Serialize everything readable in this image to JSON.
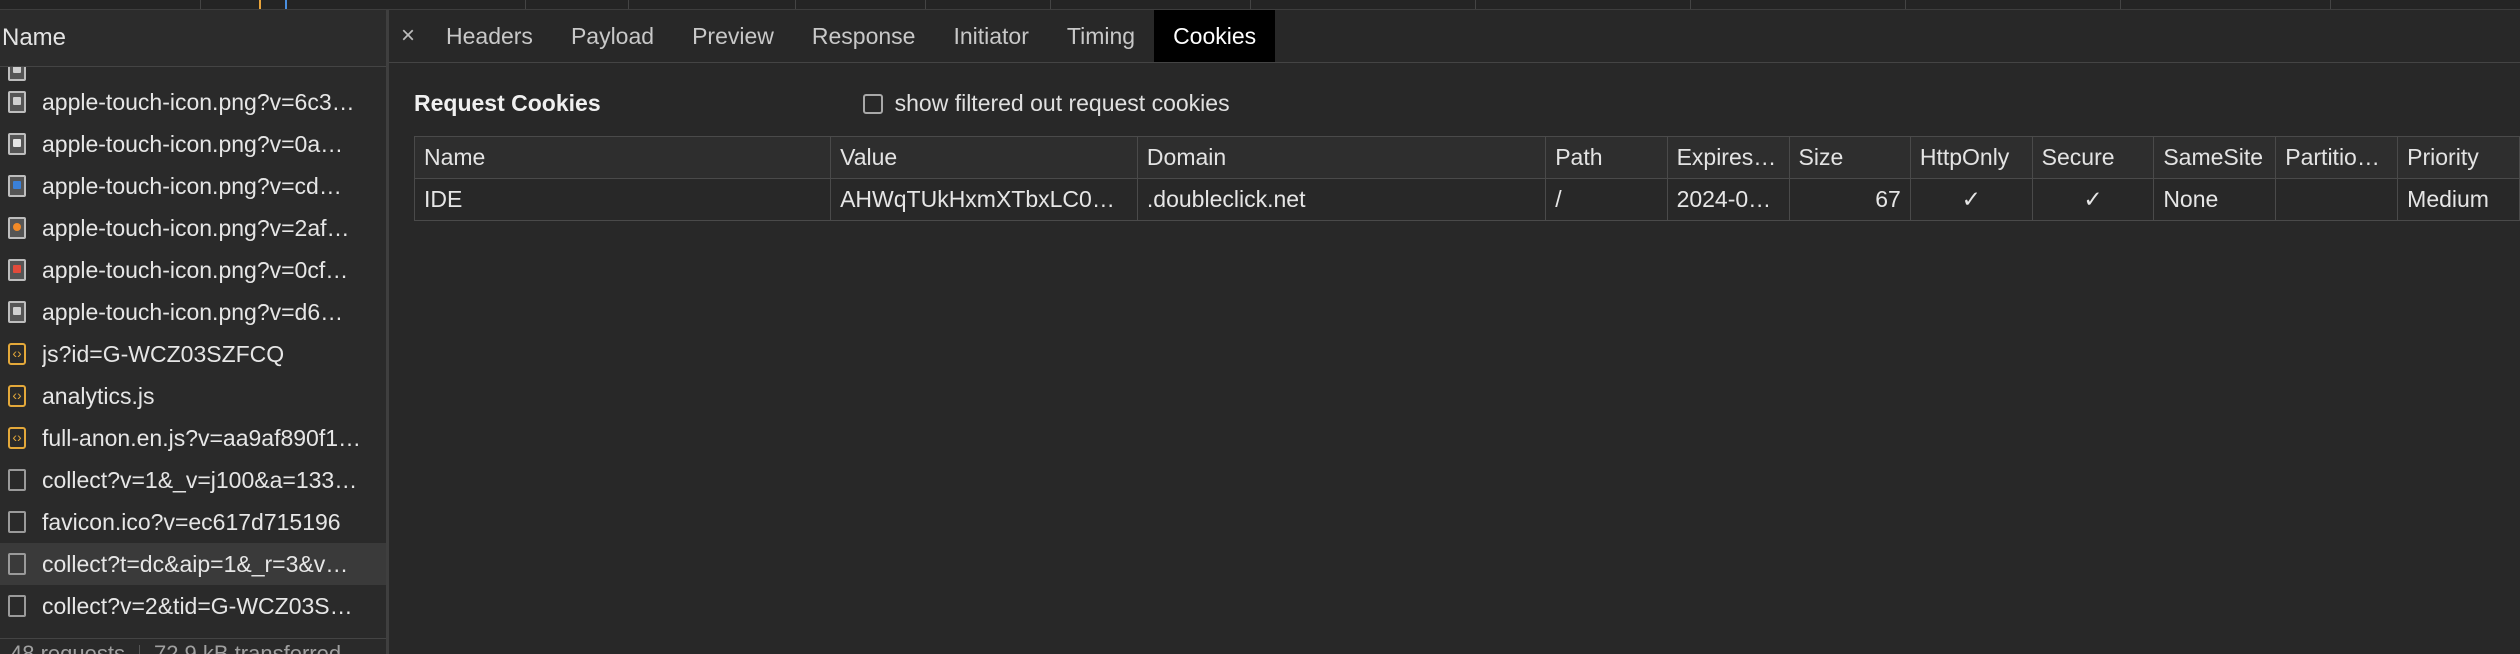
{
  "request_list": {
    "column_header": "Name",
    "requests": [
      {
        "name": "apple-touch-icon.png?v=6c3…",
        "icon": "image-icon"
      },
      {
        "name": "apple-touch-icon.png?v=0a…",
        "icon": "image-icon"
      },
      {
        "name": "apple-touch-icon.png?v=cd…",
        "icon": "image-icon"
      },
      {
        "name": "apple-touch-icon.png?v=2af…",
        "icon": "image-icon"
      },
      {
        "name": "apple-touch-icon.png?v=0cf…",
        "icon": "image-icon"
      },
      {
        "name": "apple-touch-icon.png?v=d6…",
        "icon": "image-icon"
      },
      {
        "name": "js?id=G-WCZ03SZFCQ",
        "icon": "script-icon"
      },
      {
        "name": "analytics.js",
        "icon": "script-icon"
      },
      {
        "name": "full-anon.en.js?v=aa9af890f1…",
        "icon": "script-icon"
      },
      {
        "name": "collect?v=1&_v=j100&a=133…",
        "icon": "document-icon"
      },
      {
        "name": "favicon.ico?v=ec617d715196",
        "icon": "document-icon"
      },
      {
        "name": "collect?t=dc&aip=1&_r=3&v…",
        "icon": "document-icon",
        "selected": true
      },
      {
        "name": "collect?v=2&tid=G-WCZ03S…",
        "icon": "document-icon"
      }
    ],
    "status": {
      "requests": "48 requests",
      "transferred": "72.9 kB transferred"
    }
  },
  "tabs": {
    "close": "×",
    "items": [
      "Headers",
      "Payload",
      "Preview",
      "Response",
      "Initiator",
      "Timing",
      "Cookies"
    ],
    "active": "Cookies"
  },
  "cookies": {
    "title": "Request Cookies",
    "show_filtered_label": "show filtered out request cookies",
    "show_filtered_checked": false,
    "columns": [
      "Name",
      "Value",
      "Domain",
      "Path",
      "Expires…",
      "Size",
      "HttpOnly",
      "Secure",
      "SameSite",
      "Partitio…",
      "Priority"
    ],
    "rows": [
      {
        "name": "IDE",
        "value": "AHWqTUkHxmXTbxLC0…",
        "domain": ".doubleclick.net",
        "path": "/",
        "expires": "2024-0…",
        "size": "67",
        "httponly": "✓",
        "secure": "✓",
        "samesite": "None",
        "partition": "",
        "priority": "Medium"
      }
    ]
  },
  "colors": {
    "background": "#282828",
    "active_tab": "#000000",
    "selected_row": "#3a3a3a",
    "script_icon": "#e3a83a"
  }
}
